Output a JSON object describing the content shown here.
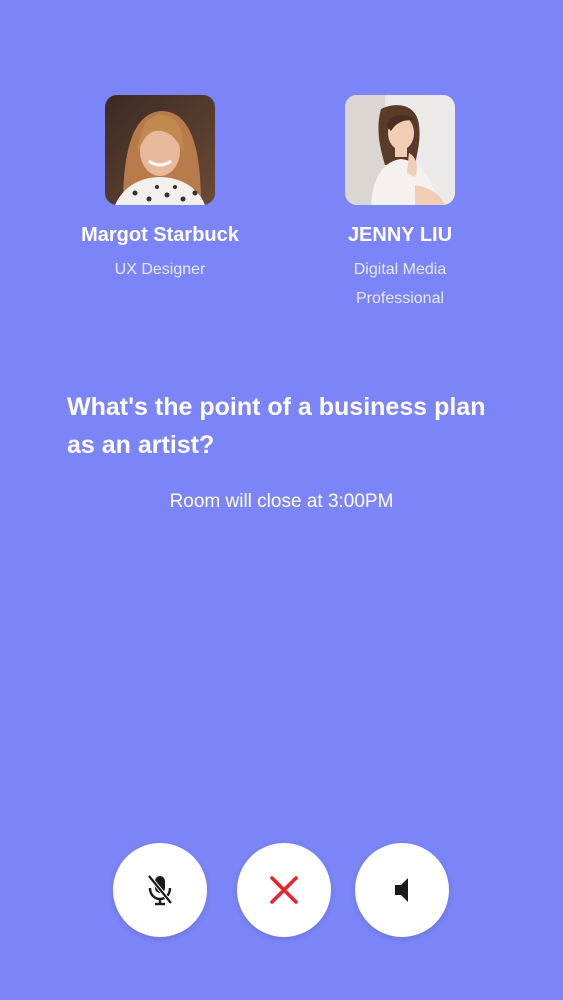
{
  "speakers": [
    {
      "name": "Margot Starbuck",
      "role": "UX Designer"
    },
    {
      "name": "JENNY LIU",
      "role_line1": "Digital Media",
      "role_line2": "Professional"
    }
  ],
  "room": {
    "question": "What's the point of a business plan as an artist?",
    "close_notice": "Room will close at 3:00PM"
  },
  "controls": {
    "mute_icon": "mic-off-icon",
    "end_icon": "close-icon",
    "speaker_icon": "speaker-icon"
  },
  "colors": {
    "background": "#7b85f8",
    "end_call_red": "#e3262b",
    "icon_dark": "#1a1a1a"
  }
}
